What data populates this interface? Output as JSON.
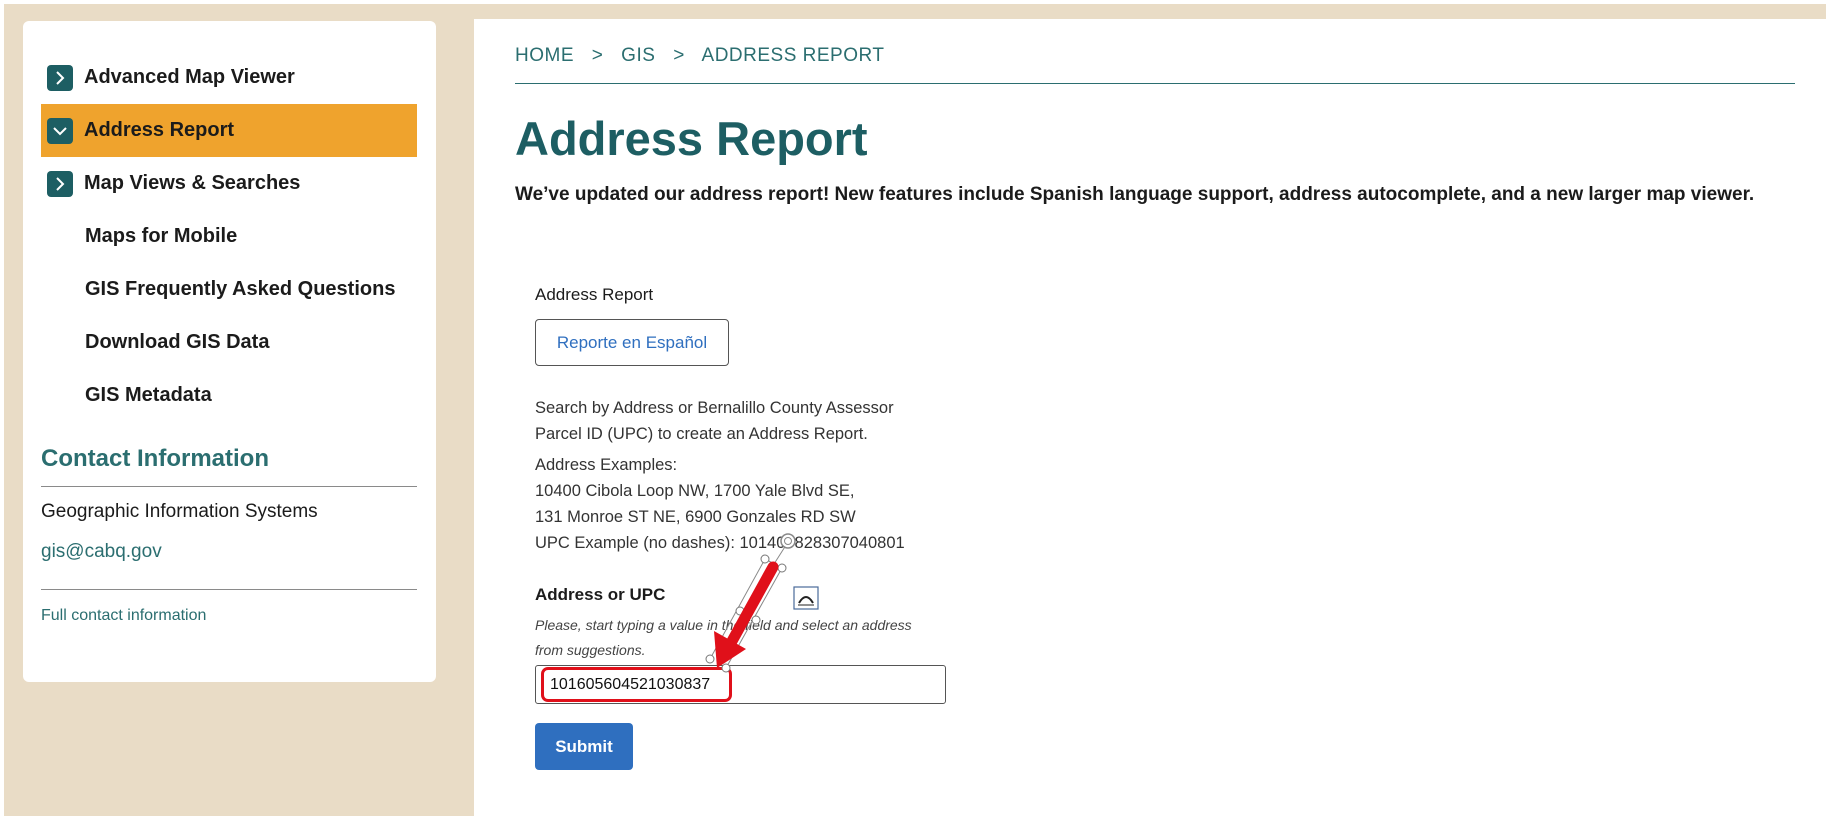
{
  "sidebar": {
    "items": [
      {
        "label": "Advanced Map Viewer",
        "icon": "chevron-right-icon"
      },
      {
        "label": "Address Report",
        "icon": "chevron-down-icon"
      },
      {
        "label": "Map Views & Searches",
        "icon": "chevron-right-icon"
      },
      {
        "label": "Maps for Mobile"
      },
      {
        "label": "GIS Frequently Asked Questions"
      },
      {
        "label": "Download GIS Data"
      },
      {
        "label": "GIS Metadata"
      }
    ],
    "contact": {
      "title": "Contact Information",
      "org": "Geographic Information Systems",
      "email": "gis@cabq.gov",
      "full_link": "Full contact information"
    }
  },
  "breadcrumb": {
    "items": [
      "HOME",
      "GIS",
      "ADDRESS REPORT"
    ],
    "separator": ">"
  },
  "main": {
    "title": "Address Report",
    "lead": "We’ve updated our address report! New features include Spanish language support, address autocomplete, and a new larger map viewer.",
    "form": {
      "section_label": "Address Report",
      "espanol_button": "Reporte en Español",
      "desc_lines": [
        "Search by Address or Bernalillo County Assessor",
        "Parcel ID (UPC) to create an Address Report.",
        "Address Examples:",
        "10400 Cibola Loop NW, 1700 Yale Blvd SE,",
        "131 Monroe ST NE, 6900 Gonzales RD SW",
        "UPC Example (no dashes): 101405828307040801"
      ],
      "field_label": "Address or UPC",
      "help_lines": [
        "Please, start typing a value in the field and select an address",
        "from suggestions."
      ],
      "input_value": "101605604521030837",
      "submit_label": "Submit"
    }
  },
  "colors": {
    "accent_teal": "#1d5e63",
    "active_orange": "#efa32d",
    "button_blue": "#2f6fbf",
    "page_bg": "#e9dcc6",
    "annotation_red": "#e0101a"
  }
}
